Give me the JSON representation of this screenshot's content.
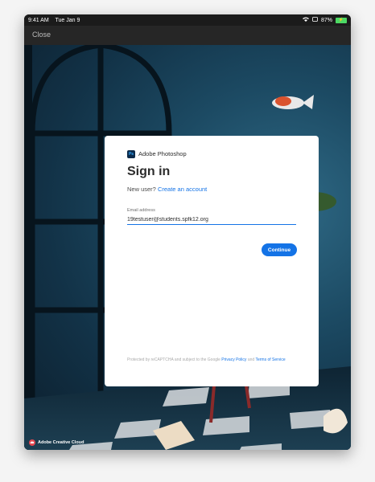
{
  "status_bar": {
    "time": "9:41 AM",
    "date": "Tue Jan 9",
    "battery_percent": "87%"
  },
  "nav": {
    "close_label": "Close"
  },
  "card": {
    "app_name": "Adobe Photoshop",
    "app_logo_text": "Ps",
    "title": "Sign in",
    "new_user_text": "New user?",
    "create_account_link": "Create an account",
    "email_label": "Email address",
    "email_value": "19testuser@students.spfk12.org",
    "continue_label": "Continue",
    "legal_text": "Protected by reCAPTCHA and subject to the Google",
    "privacy_link": "Privacy Policy",
    "and_text": "and",
    "terms_link": "Terms of Service"
  },
  "footer": {
    "brand": "Adobe Creative Cloud"
  },
  "colors": {
    "accent": "#1473e6",
    "battery": "#4cd964"
  }
}
